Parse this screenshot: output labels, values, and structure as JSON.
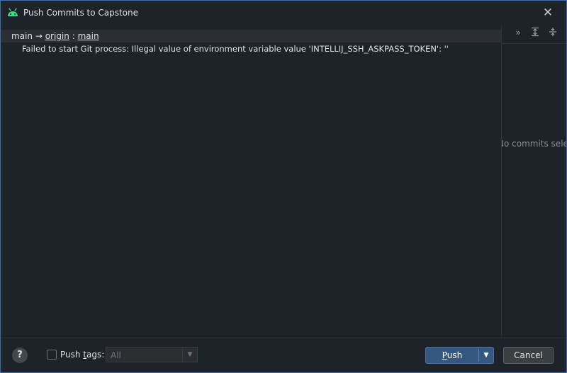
{
  "window": {
    "title": "Push Commits to Capstone",
    "app_icon": "android-icon",
    "close_icon": "close-icon"
  },
  "branch": {
    "local": "main",
    "arrow": "→",
    "remote": "origin",
    "separator": ":",
    "remote_branch": "main"
  },
  "error_message": "Failed to start Git process: Illegal value of environment variable value 'INTELLIJ_SSH_ASKPASS_TOKEN': ''",
  "right_panel": {
    "hint": "No commits selected",
    "toolbar_icons": [
      "expand-more-icon",
      "expand-all-icon",
      "collapse-all-icon"
    ]
  },
  "footer": {
    "help": "?",
    "push_tags_prefix": "Push ",
    "push_tags_mnemonic": "t",
    "push_tags_suffix": "ags:",
    "tags_value": "All",
    "push_mnemonic": "P",
    "push_rest": "ush",
    "cancel": "Cancel"
  },
  "colors": {
    "background": "#1e2229",
    "accent": "#365880",
    "android_green": "#3ddc84",
    "window_border": "#3a6fb0"
  }
}
